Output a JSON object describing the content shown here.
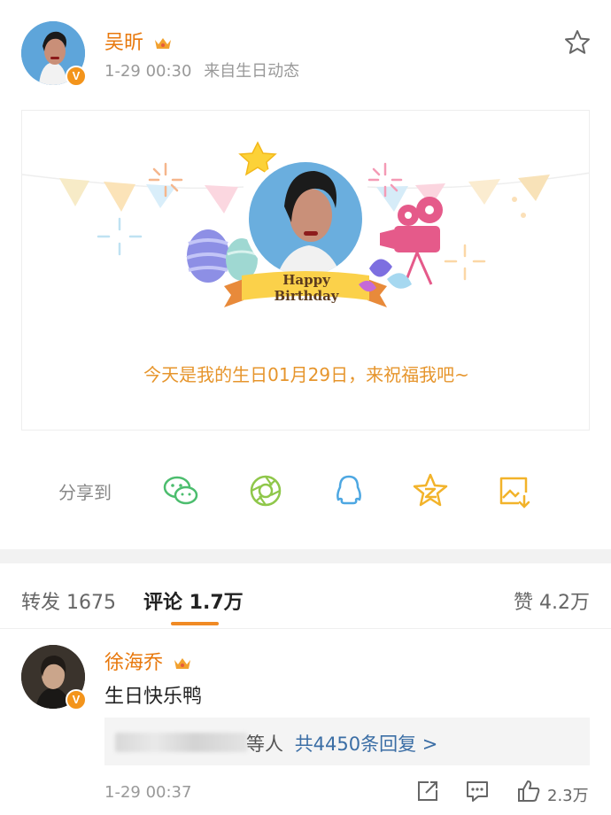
{
  "post": {
    "author": "吴昕",
    "time": "1-29 00:30",
    "source": "来自生日动态",
    "verified_badge": "V",
    "card": {
      "banner_label": "Happy Birthday",
      "message": "今天是我的生日01月29日，来祝福我吧~"
    }
  },
  "share": {
    "label": "分享到",
    "targets": [
      "wechat-icon",
      "moments-icon",
      "qq-icon",
      "qzone-icon",
      "save-image-icon"
    ]
  },
  "tabs": {
    "repost": "转发 1675",
    "comment": "评论 1.7万",
    "like": "赞 4.2万"
  },
  "comment": {
    "author": "徐海乔",
    "text": "生日快乐鸭",
    "reply_suffix": "等人",
    "reply_count": "共4450条回复 >",
    "time": "1-29 00:37",
    "likes": "2.3万"
  },
  "colors": {
    "accent": "#e8780c",
    "tab_underline": "#f08a24",
    "link": "#3b6ea5"
  }
}
